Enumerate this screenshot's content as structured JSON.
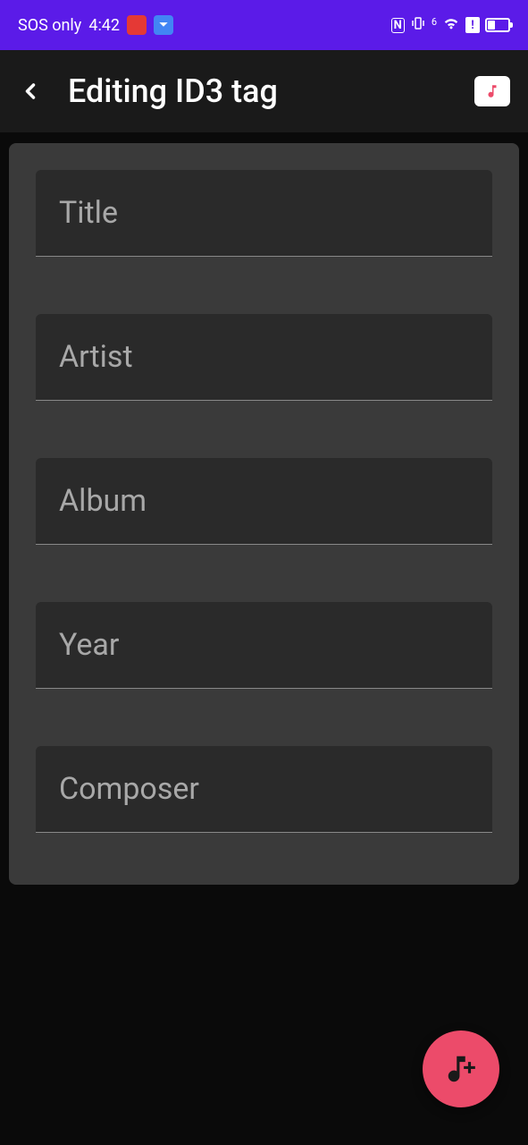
{
  "statusBar": {
    "network": "SOS only",
    "time": "4:42",
    "wifiPrefix": "6"
  },
  "header": {
    "title": "Editing ID3 tag"
  },
  "form": {
    "fields": [
      {
        "placeholder": "Title",
        "value": ""
      },
      {
        "placeholder": "Artist",
        "value": ""
      },
      {
        "placeholder": "Album",
        "value": ""
      },
      {
        "placeholder": "Year",
        "value": ""
      },
      {
        "placeholder": "Composer",
        "value": ""
      }
    ]
  }
}
